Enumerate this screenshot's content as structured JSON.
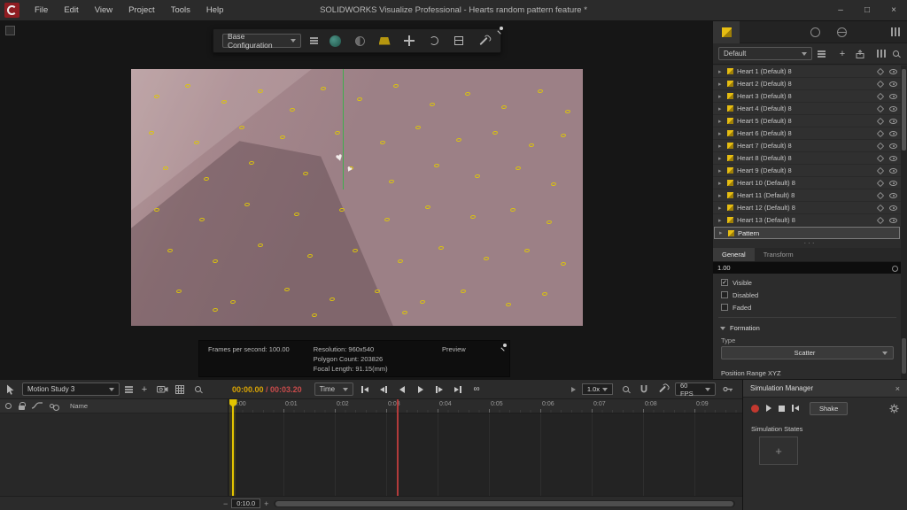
{
  "window": {
    "title": "SOLIDWORKS Visualize Professional - Hearts random pattern feature *",
    "menus": [
      "File",
      "Edit",
      "View",
      "Project",
      "Tools",
      "Help"
    ],
    "controls": {
      "minimize": "–",
      "maximize": "□",
      "close": "×"
    }
  },
  "symbols": {
    "plus": "+",
    "minus": "−",
    "infinity": "∞",
    "ellipsis": "···",
    "heart": "♥",
    "check": "✓"
  },
  "viewport": {
    "config_dropdown": "Base Configuration",
    "render_info": {
      "fps": "Frames per second: 100.00",
      "resolution": "Resolution: 960x540",
      "polygons": "Polygon Count: 203826",
      "focal": "Focal Length: 91.15(mm)",
      "mode": "Preview"
    },
    "scene": {
      "scatter_color": "#ddc50a",
      "points": [
        [
          5,
          10
        ],
        [
          12,
          6
        ],
        [
          20,
          12
        ],
        [
          28,
          8
        ],
        [
          35,
          15
        ],
        [
          42,
          7
        ],
        [
          50,
          11
        ],
        [
          58,
          6
        ],
        [
          66,
          13
        ],
        [
          74,
          9
        ],
        [
          82,
          14
        ],
        [
          90,
          8
        ],
        [
          96,
          16
        ],
        [
          4,
          24
        ],
        [
          14,
          28
        ],
        [
          24,
          22
        ],
        [
          33,
          26
        ],
        [
          45,
          24
        ],
        [
          55,
          28
        ],
        [
          63,
          22
        ],
        [
          72,
          27
        ],
        [
          80,
          24
        ],
        [
          88,
          29
        ],
        [
          95,
          25
        ],
        [
          7,
          38
        ],
        [
          16,
          42
        ],
        [
          26,
          36
        ],
        [
          38,
          40
        ],
        [
          48,
          38
        ],
        [
          57,
          43
        ],
        [
          67,
          37
        ],
        [
          76,
          41
        ],
        [
          85,
          38
        ],
        [
          93,
          44
        ],
        [
          5,
          54
        ],
        [
          15,
          58
        ],
        [
          25,
          52
        ],
        [
          36,
          56
        ],
        [
          46,
          54
        ],
        [
          56,
          58
        ],
        [
          65,
          53
        ],
        [
          75,
          57
        ],
        [
          84,
          54
        ],
        [
          92,
          59
        ],
        [
          8,
          70
        ],
        [
          18,
          74
        ],
        [
          28,
          68
        ],
        [
          39,
          72
        ],
        [
          49,
          70
        ],
        [
          59,
          74
        ],
        [
          68,
          69
        ],
        [
          78,
          73
        ],
        [
          87,
          70
        ],
        [
          95,
          75
        ],
        [
          10,
          86
        ],
        [
          22,
          90
        ],
        [
          18,
          93
        ],
        [
          34,
          85
        ],
        [
          44,
          89
        ],
        [
          54,
          86
        ],
        [
          64,
          90
        ],
        [
          73,
          86
        ],
        [
          83,
          91
        ],
        [
          91,
          87
        ],
        [
          40,
          95
        ],
        [
          60,
          94
        ]
      ]
    }
  },
  "right_panel": {
    "collection_dropdown": "Default",
    "hearts": [
      {
        "label": "Heart 1 (Default) 8"
      },
      {
        "label": "Heart 2 (Default) 8"
      },
      {
        "label": "Heart 3 (Default) 8"
      },
      {
        "label": "Heart 4 (Default) 8"
      },
      {
        "label": "Heart 5 (Default) 8"
      },
      {
        "label": "Heart 6 (Default) 8"
      },
      {
        "label": "Heart 7 (Default) 8"
      },
      {
        "label": "Heart 8 (Default) 8"
      },
      {
        "label": "Heart 9 (Default) 8"
      },
      {
        "label": "Heart 10 (Default) 8"
      },
      {
        "label": "Heart 11 (Default) 8"
      },
      {
        "label": "Heart 12 (Default) 8"
      },
      {
        "label": "Heart 13 (Default) 8"
      }
    ],
    "pattern_label": "Pattern",
    "splitter": "···",
    "tabs": [
      {
        "label": "General",
        "active": true
      },
      {
        "label": "Transform",
        "active": false
      }
    ],
    "value_field": "1.00",
    "checkboxes": [
      {
        "label": "Visible",
        "checked": true
      },
      {
        "label": "Disabled",
        "checked": false
      },
      {
        "label": "Faded",
        "checked": false
      }
    ],
    "formation": {
      "header": "Formation",
      "type_label": "Type",
      "type_value": "Scatter"
    },
    "position_range_label": "Position Range XYZ"
  },
  "timeline": {
    "study_dropdown": "Motion Study 3",
    "time_current": "00:00.00",
    "time_total": "/ 00:03.20",
    "unit_dropdown": "Time",
    "speed": "1.0x",
    "fps_dropdown": "60 FPS",
    "ticks": [
      "0:00",
      "0:01",
      "0:02",
      "0:03",
      "0:04",
      "0:05",
      "0:06",
      "0:07",
      "0:08",
      "0:09"
    ],
    "name_header": "Name",
    "range_label": "0:10.0",
    "colors": {
      "current": "#d9a404",
      "total": "#c84b4b",
      "playhead": "#e3c400",
      "end_marker": "#b23b3b"
    }
  },
  "sim_manager": {
    "title": "Simulation Manager",
    "shake_label": "Shake",
    "states_label": "Simulation States"
  }
}
